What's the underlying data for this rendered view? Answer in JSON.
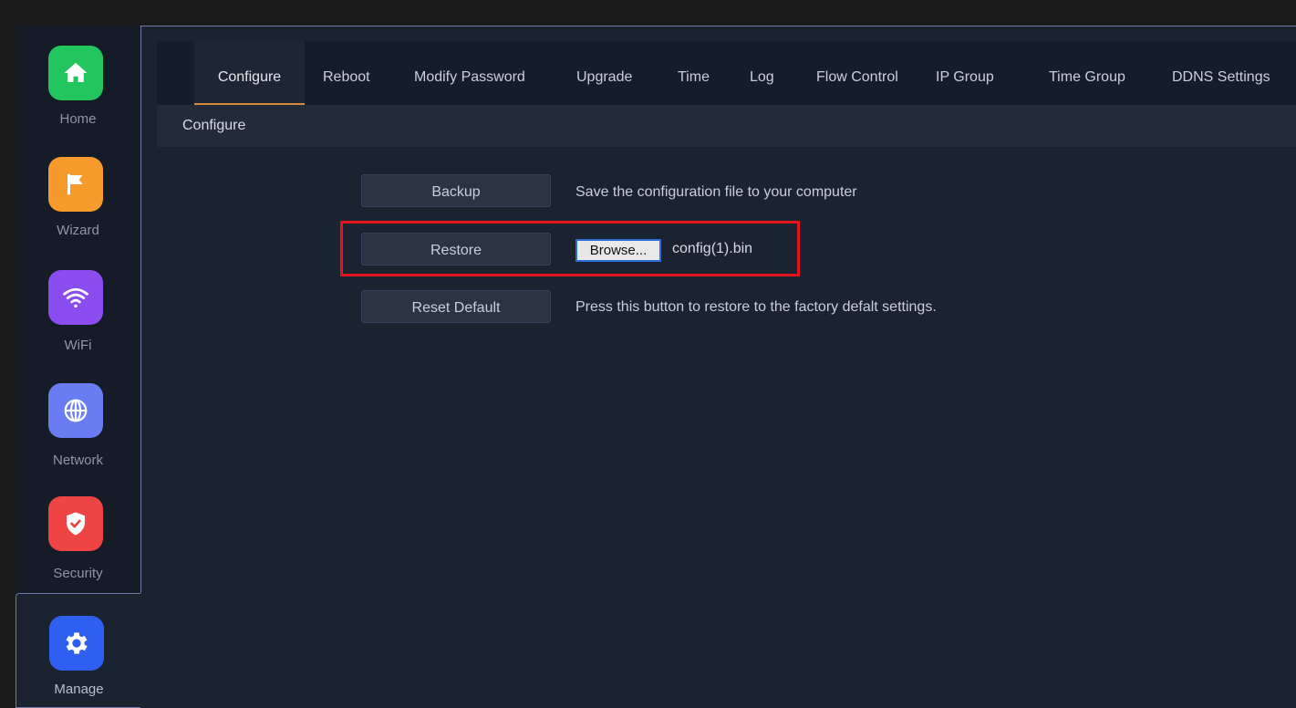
{
  "sidebar": {
    "items": [
      {
        "label": "Home",
        "icon": "home-icon",
        "color": "#22c55e"
      },
      {
        "label": "Wizard",
        "icon": "flag-icon",
        "color": "#f59a2b"
      },
      {
        "label": "WiFi",
        "icon": "wifi-icon",
        "color": "#8b4cf0"
      },
      {
        "label": "Network",
        "icon": "globe-icon",
        "color": "#6a7cf2"
      },
      {
        "label": "Security",
        "icon": "shield-icon",
        "color": "#ef4444"
      },
      {
        "label": "Manage",
        "icon": "gear-icon",
        "color": "#2f5ff0",
        "active": true
      }
    ]
  },
  "tabs": [
    {
      "label": "Configure",
      "active": true
    },
    {
      "label": "Reboot"
    },
    {
      "label": "Modify Password"
    },
    {
      "label": "Upgrade"
    },
    {
      "label": "Time"
    },
    {
      "label": "Log"
    },
    {
      "label": "Flow Control"
    },
    {
      "label": "IP Group"
    },
    {
      "label": "Time Group"
    },
    {
      "label": "DDNS Settings"
    }
  ],
  "subheader": "Configure",
  "actions": {
    "backup": {
      "label": "Backup",
      "description": "Save the configuration file to your computer"
    },
    "restore": {
      "label": "Restore",
      "browse_label": "Browse...",
      "file_name": "config(1).bin"
    },
    "reset": {
      "label": "Reset Default",
      "description": "Press this button to restore to the factory defalt settings."
    }
  },
  "colors": {
    "accent_tab_underline": "#d8893a",
    "highlight": "#e3131b"
  }
}
